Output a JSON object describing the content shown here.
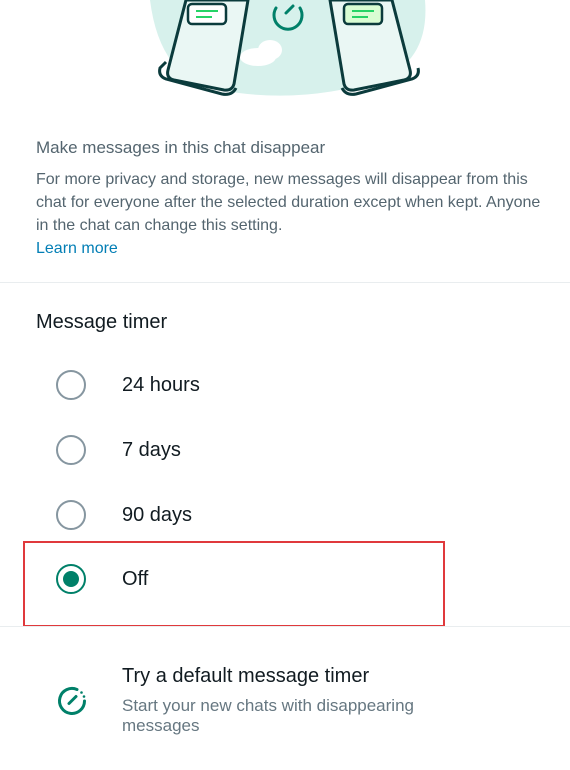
{
  "intro": {
    "title": "Make messages in this chat disappear",
    "body": "For more privacy and storage, new messages will disappear from this chat for everyone after the selected duration except when kept. Anyone in the chat can change this setting.",
    "learn_more": "Learn more"
  },
  "timer": {
    "title": "Message timer",
    "options": [
      {
        "label": "24 hours",
        "selected": false
      },
      {
        "label": "7 days",
        "selected": false
      },
      {
        "label": "90 days",
        "selected": false
      },
      {
        "label": "Off",
        "selected": true
      }
    ]
  },
  "default_timer": {
    "title": "Try a default message timer",
    "subtitle": "Start your new chats with disappearing messages"
  },
  "colors": {
    "accent": "#008069",
    "link": "#027eb5",
    "highlight": "#e0393c"
  }
}
